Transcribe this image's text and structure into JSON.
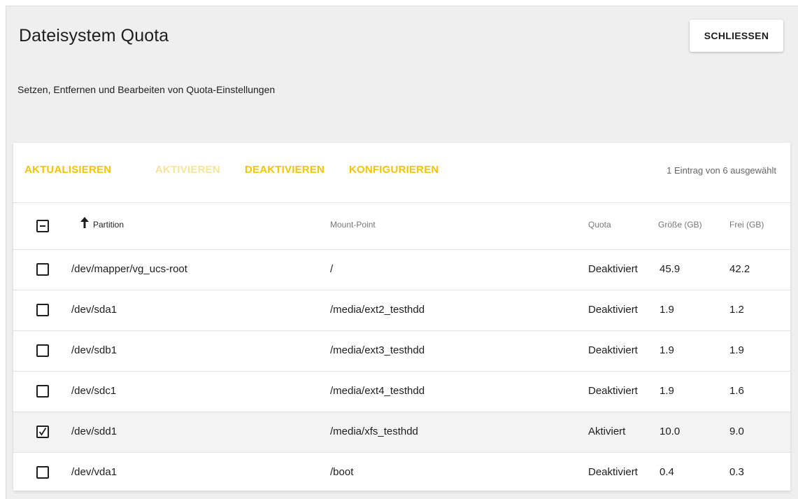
{
  "header": {
    "title": "Dateisystem Quota",
    "close_label": "SCHLIESSEN",
    "subtitle": "Setzen, Entfernen und Bearbeiten von Quota-Einstellungen"
  },
  "toolbar": {
    "refresh_label": "AKTUALISIEREN",
    "activate_label": "AKTIVIEREN",
    "deactivate_label": "DEAKTIVIEREN",
    "configure_label": "KONFIGURIEREN",
    "selection_count": "1 Eintrag von 6 ausgewählt",
    "accent_color": "#f5c400",
    "disabled_color": "#f7e49a"
  },
  "table": {
    "columns": {
      "partition": "Partition",
      "mount_point": "Mount-Point",
      "quota": "Quota",
      "size": "Größe (GB)",
      "free": "Frei (GB)"
    },
    "sort_icon": "arrow-up-icon",
    "rows": [
      {
        "partition": "/dev/mapper/vg_ucs-root",
        "mount_point": "/",
        "quota": "Deaktiviert",
        "size": "45.9",
        "free": "42.2",
        "checked": false
      },
      {
        "partition": "/dev/sda1",
        "mount_point": "/media/ext2_testhdd",
        "quota": "Deaktiviert",
        "size": "1.9",
        "free": "1.2",
        "checked": false
      },
      {
        "partition": "/dev/sdb1",
        "mount_point": "/media/ext3_testhdd",
        "quota": "Deaktiviert",
        "size": "1.9",
        "free": "1.9",
        "checked": false
      },
      {
        "partition": "/dev/sdc1",
        "mount_point": "/media/ext4_testhdd",
        "quota": "Deaktiviert",
        "size": "1.9",
        "free": "1.6",
        "checked": false
      },
      {
        "partition": "/dev/sdd1",
        "mount_point": "/media/xfs_testhdd",
        "quota": "Aktiviert",
        "size": "10.0",
        "free": "9.0",
        "checked": true
      },
      {
        "partition": "/dev/vda1",
        "mount_point": "/boot",
        "quota": "Deaktiviert",
        "size": "0.4",
        "free": "0.3",
        "checked": false
      }
    ]
  }
}
